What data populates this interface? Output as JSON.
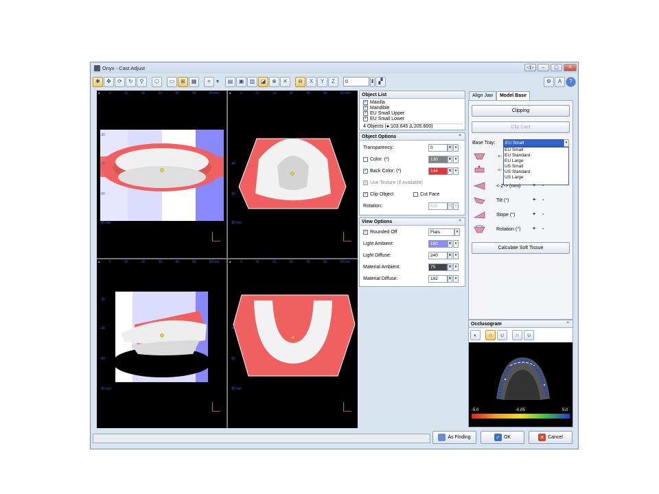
{
  "window": {
    "title": "Onyx - Cast Adjust",
    "controls": [
      "◁▷",
      "–",
      "▢",
      "✕"
    ]
  },
  "toolbar": {
    "spin_value": "0"
  },
  "views": {
    "top_ruler": [
      "0",
      "10",
      "20",
      "30",
      "40",
      "50",
      "60 mm"
    ],
    "left_ruler_tl": [
      "-20",
      "-40",
      "-60",
      "-80 mm"
    ],
    "left_ruler_short": [
      "-40",
      "-60",
      "-80 mm"
    ]
  },
  "object_list": {
    "title": "Object List",
    "items": [
      "Maxilla",
      "Mandible",
      "EU Small Upper",
      "EU Small Lower"
    ],
    "footer": "4 Objects (●:103.645 Δ:205.600)"
  },
  "object_options": {
    "title": "Object Options",
    "transparency_label": "Transparency:",
    "transparency_value": "0",
    "color_label": "Color: (*)",
    "color_value": "130",
    "back_color_label": "Back Color: (*)",
    "back_color_value": "144",
    "use_texture_label": "Use Texture",
    "use_texture_note": "(if available)",
    "clip_object_label": "Clip Object",
    "cut_face_label": "Cut Face",
    "rotation_label": "Rotation:",
    "rotation_value": "0,0"
  },
  "view_options": {
    "title": "View Options",
    "rounded_off_label": "Rounded Off",
    "rounded_off_value": "Flats",
    "light_ambient_label": "Light Ambient:",
    "light_ambient_value": "180",
    "light_diffuse_label": "Light Diffuse:",
    "light_diffuse_value": "240",
    "material_ambient_label": "Material Ambient:",
    "material_ambient_value": "75",
    "material_diffuse_label": "Material Diffuse:",
    "material_diffuse_value": "192"
  },
  "tabs": [
    "Align Jaw",
    "Model Base"
  ],
  "model_base": {
    "clipping_label": "Clipping",
    "clip_cast_label": "Clip Cast",
    "base_tray_label": "Base Tray:",
    "base_tray_value": "EU Small",
    "tray_options": [
      "EU Small",
      "EU Standard",
      "EU Large",
      "US Small",
      "US Standard",
      "US Large"
    ],
    "z_label": "<-Z-> (mm)",
    "tilt_label": "Tilt (°)",
    "slope_label": "Slope (°)",
    "rotation_label": "Rotation (°)",
    "plus": "+",
    "minus": "-",
    "calc_label": "Calculate Soft Tissue",
    "partial_arrow_1": "<-",
    "partial_arrow_2": "<-"
  },
  "occlusogram": {
    "title": "Occlusogram",
    "scale_min": "-5.0",
    "scale_mid": "-0.05",
    "scale_max": "5.0"
  },
  "footer": {
    "as_finding": "As Finding",
    "ok": "OK",
    "cancel": "Cancel"
  },
  "colors": {
    "gum": "#f06060",
    "tray_blue": "#8888ff",
    "accent": "#3a5bd0"
  }
}
